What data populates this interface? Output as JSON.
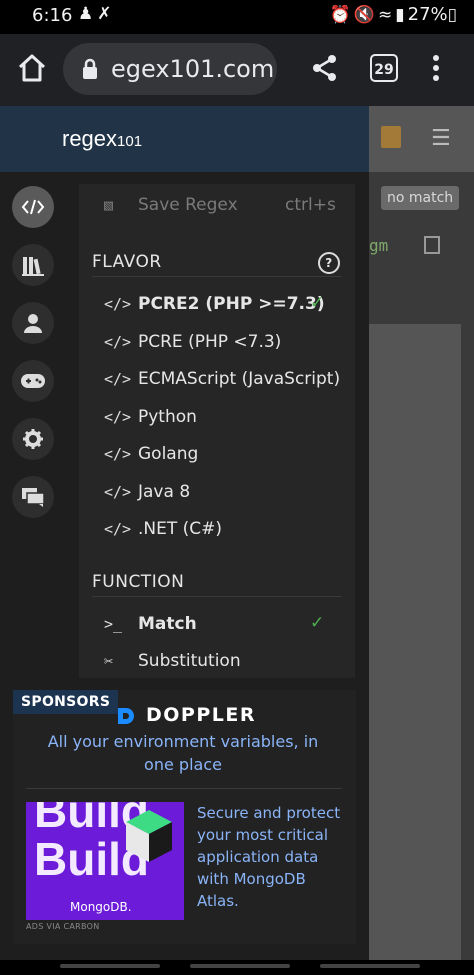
{
  "status": {
    "time": "6:16",
    "battery": "27%"
  },
  "browser": {
    "url": "egex101.com",
    "tab_count": "29"
  },
  "background": {
    "match_status": "no match",
    "flags": "gm"
  },
  "logo": {
    "main": "regex",
    "num": "101"
  },
  "menu": {
    "save": {
      "label": "Save Regex",
      "shortcut": "ctrl+s"
    },
    "flavor_heading": "FLAVOR",
    "help": "?",
    "flavors": [
      {
        "label": "PCRE2 (PHP >=7.3)",
        "selected": true
      },
      {
        "label": "PCRE (PHP <7.3)",
        "selected": false
      },
      {
        "label": "ECMAScript (JavaScript)",
        "selected": false
      },
      {
        "label": "Python",
        "selected": false
      },
      {
        "label": "Golang",
        "selected": false
      },
      {
        "label": "Java 8",
        "selected": false
      },
      {
        "label": ".NET (C#)",
        "selected": false
      }
    ],
    "function_heading": "FUNCTION",
    "functions": [
      {
        "label": "Match",
        "selected": true
      },
      {
        "label": "Substitution",
        "selected": false
      }
    ]
  },
  "sponsor": {
    "badge": "SPONSORS",
    "brand": "DOPPLER",
    "tagline": "All your environment variables, in one place",
    "ad_image_text": "Build",
    "ad_image_brand": "MongoDB.",
    "ad_text": "Secure and protect your most critical application data with MongoDB Atlas.",
    "ads_via": "ADS VIA CARBON"
  },
  "colors": {
    "accent_check": "#4caf50",
    "link": "#8ab4f8",
    "header": "#203347",
    "ad_bg": "#6c1bd9"
  }
}
